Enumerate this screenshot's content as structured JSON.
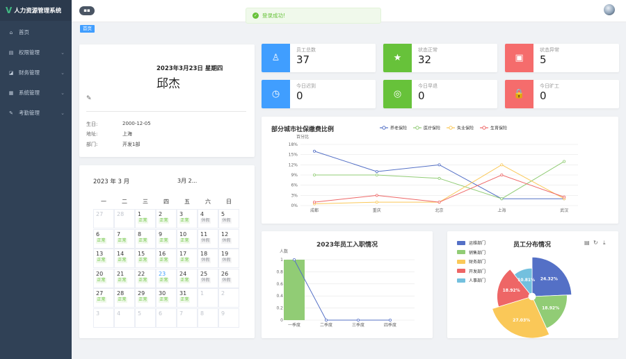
{
  "app": {
    "title": "人力资源管理系统"
  },
  "sidebar": {
    "items": [
      {
        "label": "首页",
        "icon": "home-icon",
        "has_children": false
      },
      {
        "label": "权限管理",
        "icon": "lock-icon",
        "has_children": true
      },
      {
        "label": "财务管理",
        "icon": "chart-icon",
        "has_children": true
      },
      {
        "label": "系统管理",
        "icon": "bar-icon",
        "has_children": true
      },
      {
        "label": "考勤管理",
        "icon": "edit-icon",
        "has_children": true
      }
    ]
  },
  "toast": {
    "message": "登录成功!"
  },
  "tags": {
    "home": "首页"
  },
  "profile": {
    "date": "2023年3月23日 星期四",
    "name": "邱杰",
    "fields": [
      {
        "key": "生日:",
        "value": "2000-12-05"
      },
      {
        "key": "地址:",
        "value": "上海"
      },
      {
        "key": "部门:",
        "value": "开发1部"
      }
    ]
  },
  "stats": [
    {
      "label": "员工总数",
      "value": "37",
      "color": "#409eff",
      "icon": "user-icon"
    },
    {
      "label": "状态正常",
      "value": "32",
      "color": "#67c23a",
      "icon": "star-icon"
    },
    {
      "label": "状态异常",
      "value": "5",
      "color": "#f56c6c",
      "icon": "bag-icon"
    },
    {
      "label": "今日迟到",
      "value": "0",
      "color": "#409eff",
      "icon": "stopwatch-icon"
    },
    {
      "label": "今日早退",
      "value": "0",
      "color": "#67c23a",
      "icon": "watch-icon"
    },
    {
      "label": "今日旷工",
      "value": "0",
      "color": "#f56c6c",
      "icon": "padlock-icon"
    }
  ],
  "calendar": {
    "title": "2023 年 3 月",
    "hint": "3月  2...",
    "weekdays": [
      "一",
      "二",
      "三",
      "四",
      "五",
      "六",
      "日"
    ],
    "weeks": [
      [
        {
          "d": "27",
          "dim": true
        },
        {
          "d": "28",
          "dim": true
        },
        {
          "d": "1",
          "s": "正常"
        },
        {
          "d": "2",
          "s": "正常"
        },
        {
          "d": "3",
          "s": "正常"
        },
        {
          "d": "4",
          "s": "休假"
        },
        {
          "d": "5",
          "s": "休假"
        }
      ],
      [
        {
          "d": "6",
          "s": "正常"
        },
        {
          "d": "7",
          "s": "正常"
        },
        {
          "d": "8",
          "s": "正常"
        },
        {
          "d": "9",
          "s": "正常"
        },
        {
          "d": "10",
          "s": "正常"
        },
        {
          "d": "11",
          "s": "休假"
        },
        {
          "d": "12",
          "s": "休假"
        }
      ],
      [
        {
          "d": "13",
          "s": "正常"
        },
        {
          "d": "14",
          "s": "正常"
        },
        {
          "d": "15",
          "s": "正常"
        },
        {
          "d": "16",
          "s": "正常"
        },
        {
          "d": "17",
          "s": "正常"
        },
        {
          "d": "18",
          "s": "休假"
        },
        {
          "d": "19",
          "s": "休假"
        }
      ],
      [
        {
          "d": "20",
          "s": "正常"
        },
        {
          "d": "21",
          "s": "正常"
        },
        {
          "d": "22",
          "s": "正常"
        },
        {
          "d": "23",
          "s": "正常",
          "today": true
        },
        {
          "d": "24",
          "s": "正常"
        },
        {
          "d": "25",
          "s": "休假"
        },
        {
          "d": "26",
          "s": "休假"
        }
      ],
      [
        {
          "d": "27",
          "s": "正常"
        },
        {
          "d": "28",
          "s": "正常"
        },
        {
          "d": "29",
          "s": "正常"
        },
        {
          "d": "30",
          "s": "正常"
        },
        {
          "d": "31",
          "s": "正常"
        },
        {
          "d": "1",
          "dim": true
        },
        {
          "d": "2",
          "dim": true
        }
      ],
      [
        {
          "d": "3",
          "dim": true
        },
        {
          "d": "4",
          "dim": true
        },
        {
          "d": "5",
          "dim": true
        },
        {
          "d": "6",
          "dim": true
        },
        {
          "d": "7",
          "dim": true
        },
        {
          "d": "8",
          "dim": true
        },
        {
          "d": "9",
          "dim": true
        }
      ]
    ]
  },
  "chart_data": [
    {
      "type": "line",
      "title": "部分城市社保缴费比例",
      "ylabel": "百分比",
      "categories": [
        "成都",
        "重庆",
        "北京",
        "上海",
        "武汉"
      ],
      "ylim": [
        0,
        18
      ],
      "yticks": [
        "0%",
        "3%",
        "6%",
        "9%",
        "12%",
        "15%",
        "18%"
      ],
      "series": [
        {
          "name": "养老保险",
          "color": "#5470c6",
          "values": [
            16,
            10,
            12,
            2,
            2
          ]
        },
        {
          "name": "医疗保险",
          "color": "#91cc75",
          "values": [
            9,
            9,
            8,
            2,
            13
          ]
        },
        {
          "name": "失业保险",
          "color": "#fac858",
          "values": [
            0.5,
            1,
            1,
            12,
            2
          ]
        },
        {
          "name": "生育保险",
          "color": "#ee6666",
          "values": [
            1,
            3,
            1,
            9,
            2.5
          ]
        }
      ]
    },
    {
      "type": "bar",
      "title": "2023年员工入职情况",
      "ylabel": "人数",
      "categories": [
        "一季度",
        "二季度",
        "三季度",
        "四季度"
      ],
      "values": [
        1,
        0,
        0,
        0
      ],
      "ylim": [
        0,
        1
      ],
      "yticks": [
        "0",
        "0.2",
        "0.4",
        "0.6",
        "0.8",
        "1"
      ],
      "bar_color": "#91cc75",
      "line_color": "#5470c6"
    },
    {
      "type": "pie",
      "title": "员工分布情况",
      "rose": true,
      "slices": [
        {
          "name": "运维部门",
          "value": 24.32,
          "label": "24.32%",
          "color": "#5470c6"
        },
        {
          "name": "销售部门",
          "value": 18.92,
          "label": "18.92%",
          "color": "#91cc75"
        },
        {
          "name": "财务部门",
          "value": 27.03,
          "label": "27.03%",
          "color": "#fac858"
        },
        {
          "name": "开发部门",
          "value": 18.92,
          "label": "18.92%",
          "color": "#ee6666"
        },
        {
          "name": "人事部门",
          "value": 10.81,
          "label": "10.81%",
          "color": "#73c0de"
        }
      ]
    }
  ]
}
